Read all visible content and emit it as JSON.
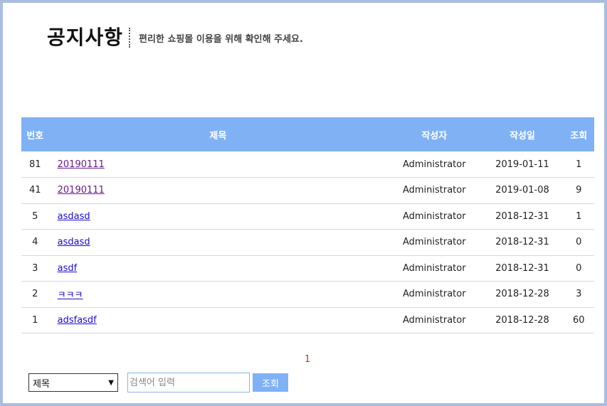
{
  "header": {
    "title": "공지사항",
    "subtitle": "편리한 쇼핑몰 이용을 위해 확인해 주세요."
  },
  "table": {
    "columns": [
      "번호",
      "제목",
      "작성자",
      "작성일",
      "조회"
    ],
    "rows": [
      {
        "no": "81",
        "title": "20190111",
        "author": "Administrator",
        "date": "2019-01-11",
        "views": "1",
        "visited": true
      },
      {
        "no": "41",
        "title": "20190111",
        "author": "Administrator",
        "date": "2019-01-08",
        "views": "9",
        "visited": true
      },
      {
        "no": "5",
        "title": "asdasd",
        "author": "Administrator",
        "date": "2018-12-31",
        "views": "1",
        "visited": false
      },
      {
        "no": "4",
        "title": "asdasd",
        "author": "Administrator",
        "date": "2018-12-31",
        "views": "0",
        "visited": false
      },
      {
        "no": "3",
        "title": "asdf",
        "author": "Administrator",
        "date": "2018-12-31",
        "views": "0",
        "visited": false
      },
      {
        "no": "2",
        "title": "ㅋㅋㅋ",
        "author": "Administrator",
        "date": "2018-12-28",
        "views": "3",
        "visited": false
      },
      {
        "no": "1",
        "title": "adsfasdf",
        "author": "Administrator",
        "date": "2018-12-28",
        "views": "60",
        "visited": false
      }
    ]
  },
  "pagination": {
    "current_page": "1"
  },
  "search": {
    "selected_field": "제목",
    "placeholder": "검색어 입력",
    "button_label": "조회"
  },
  "colors": {
    "header_bg": "#7fb1f4",
    "frame_border": "#a9bde0",
    "page_number": "#e02424"
  }
}
